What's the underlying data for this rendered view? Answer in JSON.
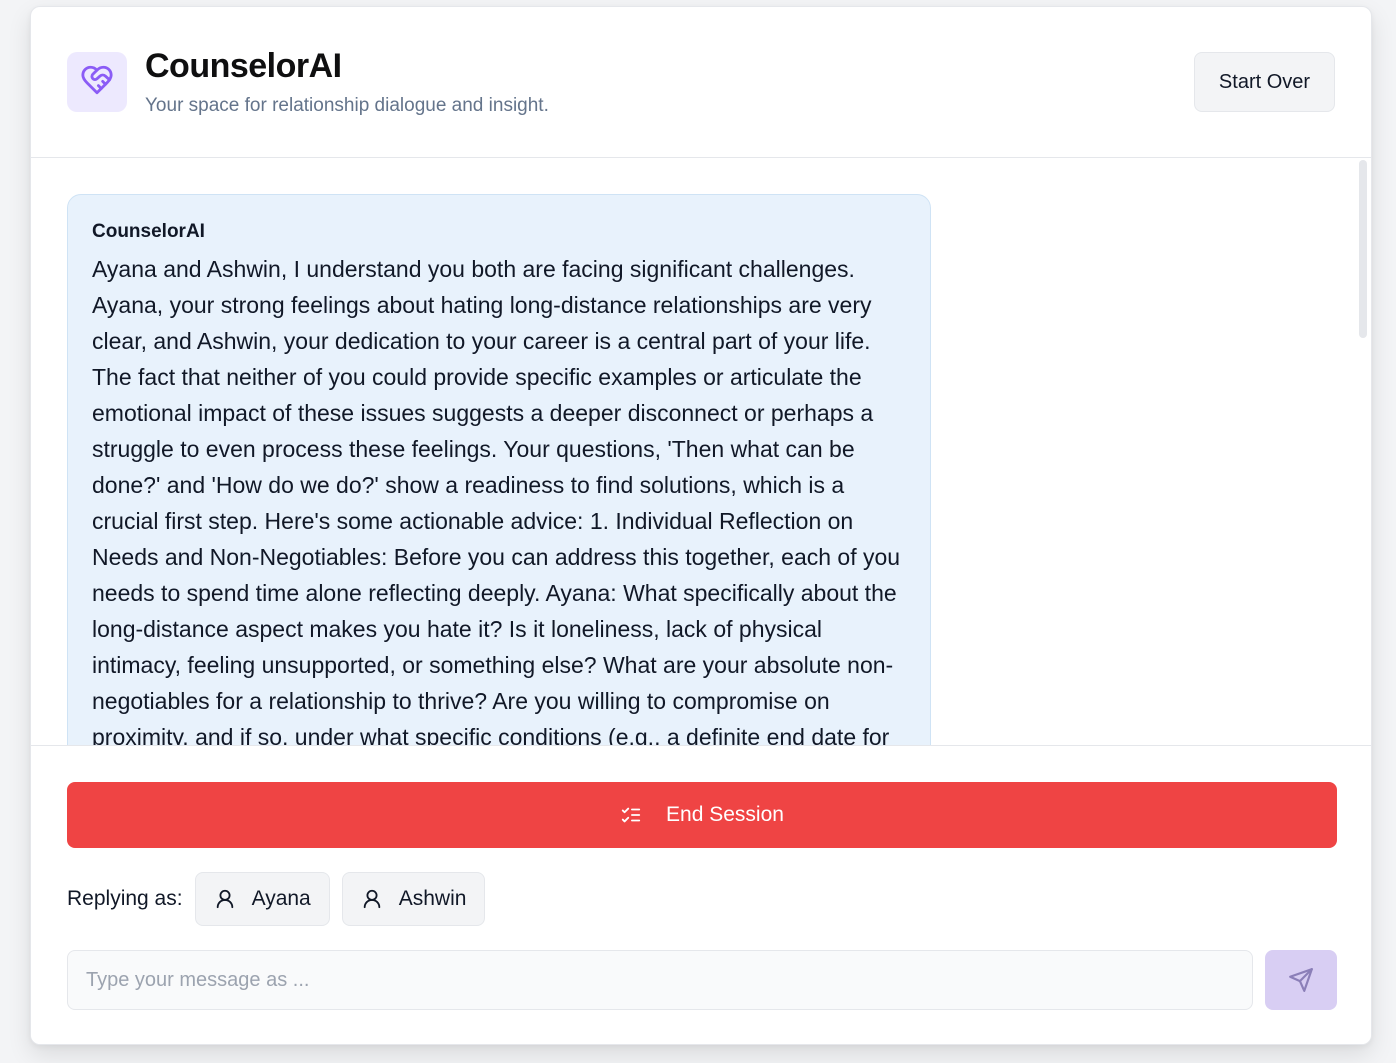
{
  "header": {
    "logo_icon": "heart-handshake-icon",
    "title": "CounselorAI",
    "subtitle": "Your space for relationship dialogue and insight.",
    "start_over_label": "Start Over"
  },
  "conversation": {
    "messages": [
      {
        "sender": "CounselorAI",
        "text": "Ayana and Ashwin, I understand you both are facing significant challenges. Ayana, your strong feelings about hating long-distance relationships are very clear, and Ashwin, your dedication to your career is a central part of your life. The fact that neither of you could provide specific examples or articulate the emotional impact of these issues suggests a deeper disconnect or perhaps a struggle to even process these feelings. Your questions, 'Then what can be done?' and 'How do we do?' show a readiness to find solutions, which is a crucial first step. Here's some actionable advice: 1. Individual Reflection on Needs and Non-Negotiables: Before you can address this together, each of you needs to spend time alone reflecting deeply. Ayana: What specifically about the long-distance aspect makes you hate it? Is it loneliness, lack of physical intimacy, feeling unsupported, or something else? What are your absolute non-negotiables for a relationship to thrive? Are you willing to compromise on proximity, and if so, under what specific conditions (e.g., a definite end date for"
      }
    ]
  },
  "footer": {
    "end_session_label": "End Session",
    "end_session_icon": "list-checks-icon",
    "replying_as_label": "Replying as:",
    "personas": [
      {
        "name": "Ayana",
        "icon": "user-icon"
      },
      {
        "name": "Ashwin",
        "icon": "user-icon"
      }
    ],
    "input_placeholder": "Type your message as ...",
    "input_value": "",
    "send_icon": "send-icon"
  },
  "colors": {
    "accent_purple": "#8b5cf6",
    "end_session_red": "#ef4444",
    "bubble_blue": "#e8f2fc",
    "send_disabled": "#d8cef3"
  }
}
